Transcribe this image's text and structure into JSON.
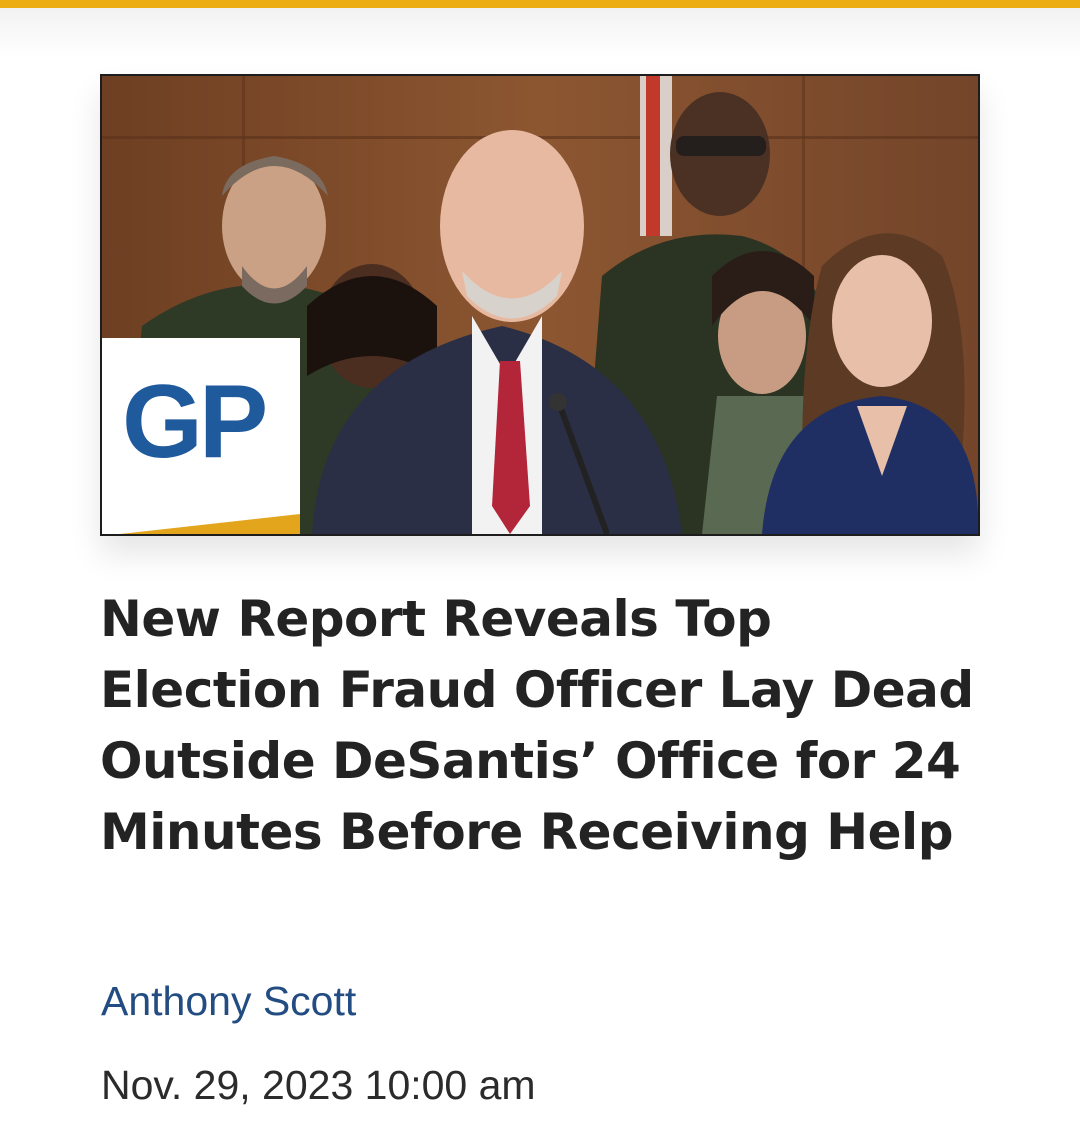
{
  "colors": {
    "accent_bar": "#ecad13",
    "headline": "#232323",
    "author_link": "#224c82",
    "date_text": "#2b2b2b",
    "logo_blue": "#1f5a9c"
  },
  "article": {
    "image_alt": "press-conference-photo",
    "logo": {
      "text": "GP"
    },
    "headline": "New Report Reveals Top Election Fraud Officer Lay Dead Outside DeSantis’ Office for 24 Minutes Before Receiving Help",
    "author": "Anthony Scott",
    "date": "Nov. 29, 2023 10:00 am"
  }
}
